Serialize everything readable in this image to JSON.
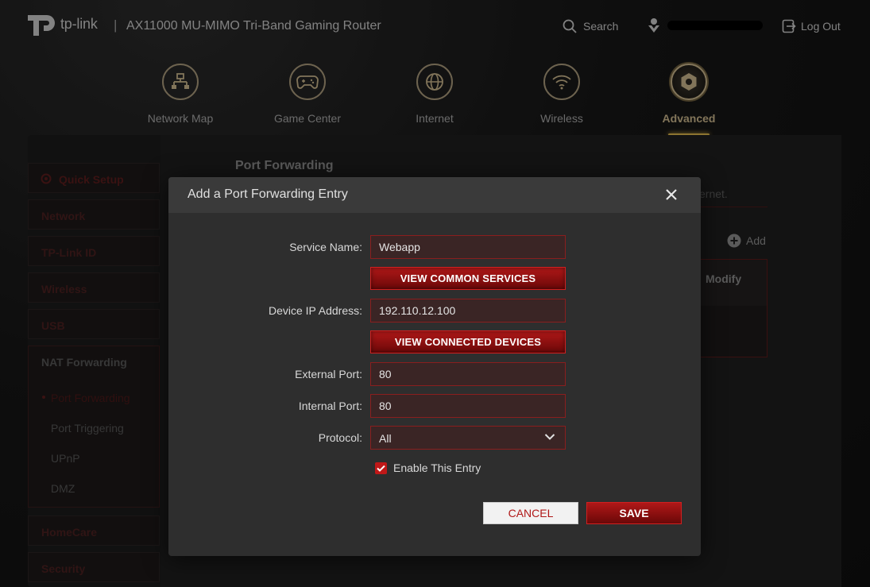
{
  "header": {
    "brand": "tp-link",
    "separator": "|",
    "model": "AX11000 MU-MIMO Tri-Band Gaming Router",
    "search_label": "Search",
    "logout_label": "Log Out"
  },
  "nav": {
    "items": [
      {
        "label": "Network Map",
        "icon": "network-map-icon"
      },
      {
        "label": "Game Center",
        "icon": "gamepad-icon"
      },
      {
        "label": "Internet",
        "icon": "globe-icon"
      },
      {
        "label": "Wireless",
        "icon": "wifi-icon"
      },
      {
        "label": "Advanced",
        "icon": "gear-icon",
        "active": true
      }
    ]
  },
  "sidebar": {
    "items": [
      {
        "label": "Quick Setup"
      },
      {
        "label": "Network"
      },
      {
        "label": "TP-Link ID"
      },
      {
        "label": "Wireless"
      },
      {
        "label": "USB"
      },
      {
        "label": "NAT Forwarding",
        "open": true
      },
      {
        "label": "HomeCare"
      },
      {
        "label": "Security"
      }
    ],
    "nat_sub": [
      {
        "label": "Port Forwarding",
        "active": true
      },
      {
        "label": "Port Triggering"
      },
      {
        "label": "UPnP"
      },
      {
        "label": "DMZ"
      }
    ]
  },
  "page": {
    "title": "Port Forwarding",
    "desc_fragment": "ernet.",
    "add_label": "Add",
    "table_modify_header": "Modify"
  },
  "modal": {
    "title": "Add a Port Forwarding Entry",
    "service_name_label": "Service Name:",
    "service_name_value": "Webapp",
    "view_common_services": "VIEW COMMON SERVICES",
    "device_ip_label": "Device IP Address:",
    "device_ip_value": "192.110.12.100",
    "view_connected_devices": "VIEW CONNECTED DEVICES",
    "external_port_label": "External Port:",
    "external_port_value": "80",
    "internal_port_label": "Internal Port:",
    "internal_port_value": "80",
    "protocol_label": "Protocol:",
    "protocol_value": "All",
    "enable_label": "Enable This Entry",
    "enable_checked": true,
    "cancel_label": "CANCEL",
    "save_label": "SAVE"
  },
  "colors": {
    "accent_red": "#c01818",
    "gold": "#c8b48a",
    "background": "#141414"
  }
}
